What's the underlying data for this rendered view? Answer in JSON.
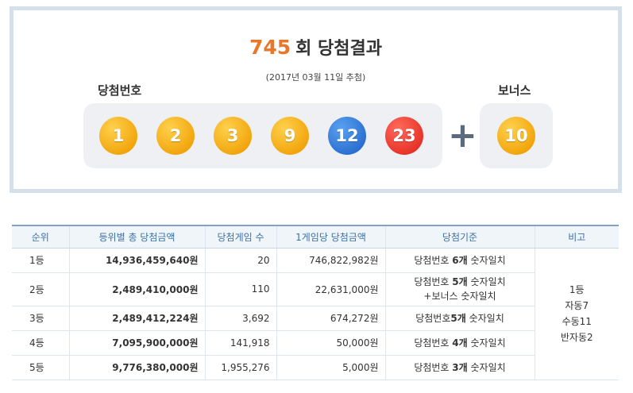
{
  "header": {
    "round": "745",
    "title_suffix": "회 당첨결과",
    "date": "(2017년 03월 11일 추첨)",
    "label_main": "당첨번호",
    "label_bonus": "보너스",
    "plus": "+"
  },
  "balls": [
    {
      "number": "1",
      "color": "#f2a70f"
    },
    {
      "number": "2",
      "color": "#f2a70f"
    },
    {
      "number": "3",
      "color": "#f2a70f"
    },
    {
      "number": "9",
      "color": "#f2a70f"
    },
    {
      "number": "12",
      "color": "#2d72d2"
    },
    {
      "number": "23",
      "color": "#e8352b"
    }
  ],
  "bonus": {
    "number": "10",
    "color": "#f2a70f"
  },
  "table": {
    "headers": [
      "순위",
      "등위별 총 당첨금액",
      "당첨게임 수",
      "1게임당 당첨금액",
      "당첨기준",
      "비고"
    ],
    "rows": [
      {
        "rank": "1등",
        "total": "14,936,459,640원",
        "count": "20",
        "per": "746,822,982원",
        "criteria_pre": "당첨번호 ",
        "criteria_bold": "6개",
        "criteria_post": " 숫자일치",
        "criteria_line2": ""
      },
      {
        "rank": "2등",
        "total": "2,489,410,000원",
        "count": "110",
        "per": "22,631,000원",
        "criteria_pre": "당첨번호 ",
        "criteria_bold": "5개",
        "criteria_post": " 숫자일치",
        "criteria_line2": "+보너스 숫자일치"
      },
      {
        "rank": "3등",
        "total": "2,489,412,224원",
        "count": "3,692",
        "per": "674,272원",
        "criteria_pre": "당첨번호",
        "criteria_bold": "5개",
        "criteria_post": " 숫자일치",
        "criteria_line2": ""
      },
      {
        "rank": "4등",
        "total": "7,095,900,000원",
        "count": "141,918",
        "per": "50,000원",
        "criteria_pre": "당첨번호 ",
        "criteria_bold": "4개",
        "criteria_post": " 숫자일치",
        "criteria_line2": ""
      },
      {
        "rank": "5등",
        "total": "9,776,380,000원",
        "count": "1,955,276",
        "per": "5,000원",
        "criteria_pre": "당첨번호 ",
        "criteria_bold": "3개",
        "criteria_post": " 숫자일치",
        "criteria_line2": ""
      }
    ],
    "note": [
      "1등",
      "자동7",
      "수동11",
      "반자동2"
    ]
  }
}
